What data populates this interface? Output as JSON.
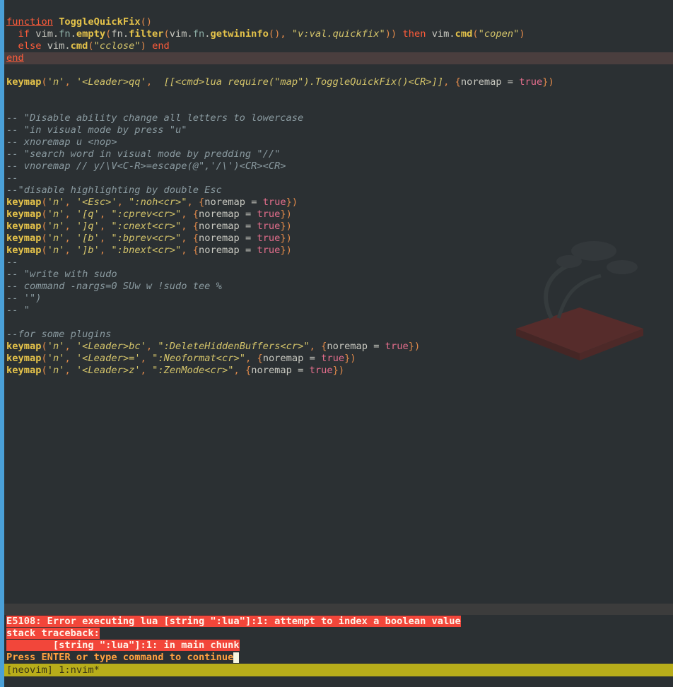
{
  "editor": {
    "lines": [
      {
        "class": "top-cut",
        "tokens": []
      },
      {
        "tokens": []
      },
      {
        "tokens": [
          [
            "kw-ul",
            "function"
          ],
          [
            "var",
            " "
          ],
          [
            "fn",
            "ToggleQuickFix"
          ],
          [
            "punc",
            "()"
          ]
        ]
      },
      {
        "tokens": [
          [
            "var",
            "  "
          ],
          [
            "kw",
            "if"
          ],
          [
            "var",
            " vim."
          ],
          [
            "mod",
            "fn"
          ],
          [
            "var",
            "."
          ],
          [
            "fn",
            "empty"
          ],
          [
            "punc",
            "("
          ],
          [
            "var",
            "fn."
          ],
          [
            "fn",
            "filter"
          ],
          [
            "punc",
            "("
          ],
          [
            "var",
            "vim."
          ],
          [
            "mod",
            "fn"
          ],
          [
            "var",
            "."
          ],
          [
            "fn",
            "getwininfo"
          ],
          [
            "punc",
            "(),"
          ],
          [
            "var",
            " "
          ],
          [
            "str",
            "\"v:val.quickfix\""
          ],
          [
            "punc",
            "))"
          ],
          [
            "var",
            " "
          ],
          [
            "kw",
            "then"
          ],
          [
            "var",
            " vim."
          ],
          [
            "fn",
            "cmd"
          ],
          [
            "punc",
            "("
          ],
          [
            "str",
            "\"copen\""
          ],
          [
            "punc",
            ")"
          ]
        ]
      },
      {
        "tokens": [
          [
            "var",
            "  "
          ],
          [
            "kw",
            "else"
          ],
          [
            "var",
            " vim."
          ],
          [
            "fn",
            "cmd"
          ],
          [
            "punc",
            "("
          ],
          [
            "str",
            "\"cclose\""
          ],
          [
            "punc",
            ")"
          ],
          [
            "var",
            " "
          ],
          [
            "kw",
            "end"
          ]
        ]
      },
      {
        "class": "cursorline",
        "tokens": [
          [
            "kw-ul",
            "end"
          ]
        ]
      },
      {
        "tokens": []
      },
      {
        "tokens": [
          [
            "fn",
            "keymap"
          ],
          [
            "punc",
            "("
          ],
          [
            "str",
            "'n'"
          ],
          [
            "punc",
            ","
          ],
          [
            "var",
            " "
          ],
          [
            "str",
            "'<Leader>qq'"
          ],
          [
            "punc",
            ","
          ],
          [
            "var",
            "  "
          ],
          [
            "str",
            "[[<cmd>lua require(\"map\").ToggleQuickFix()<CR>]]"
          ],
          [
            "punc",
            ","
          ],
          [
            "var",
            " "
          ],
          [
            "punc",
            "{"
          ],
          [
            "var",
            "noremap = "
          ],
          [
            "bool",
            "true"
          ],
          [
            "punc",
            "})"
          ]
        ]
      },
      {
        "tokens": []
      },
      {
        "tokens": []
      },
      {
        "tokens": [
          [
            "cmt",
            "-- \"Disable ability change all letters to lowercase"
          ]
        ]
      },
      {
        "tokens": [
          [
            "cmt",
            "-- \"in visual mode by press \"u\""
          ]
        ]
      },
      {
        "tokens": [
          [
            "cmt",
            "-- xnoremap u <nop>"
          ]
        ]
      },
      {
        "tokens": [
          [
            "cmt",
            "-- \"search word in visual mode by predding \"//\""
          ]
        ]
      },
      {
        "tokens": [
          [
            "cmt",
            "-- vnoremap // y/\\V<C-R>=escape(@\",'/\\')<CR><CR>"
          ]
        ]
      },
      {
        "tokens": [
          [
            "cmt",
            "--"
          ]
        ]
      },
      {
        "tokens": [
          [
            "cmt",
            "--\"disable highlighting by double Esc"
          ]
        ]
      },
      {
        "tokens": [
          [
            "fn",
            "keymap"
          ],
          [
            "punc",
            "("
          ],
          [
            "str",
            "'n'"
          ],
          [
            "punc",
            ","
          ],
          [
            "var",
            " "
          ],
          [
            "str",
            "'<Esc>'"
          ],
          [
            "punc",
            ","
          ],
          [
            "var",
            " "
          ],
          [
            "str",
            "\":noh<cr>\""
          ],
          [
            "punc",
            ","
          ],
          [
            "var",
            " "
          ],
          [
            "punc",
            "{"
          ],
          [
            "var",
            "noremap = "
          ],
          [
            "bool",
            "true"
          ],
          [
            "punc",
            "})"
          ]
        ]
      },
      {
        "tokens": [
          [
            "fn",
            "keymap"
          ],
          [
            "punc",
            "("
          ],
          [
            "str",
            "'n'"
          ],
          [
            "punc",
            ","
          ],
          [
            "var",
            " "
          ],
          [
            "str",
            "'[q'"
          ],
          [
            "punc",
            ","
          ],
          [
            "var",
            " "
          ],
          [
            "str",
            "\":cprev<cr>\""
          ],
          [
            "punc",
            ","
          ],
          [
            "var",
            " "
          ],
          [
            "punc",
            "{"
          ],
          [
            "var",
            "noremap = "
          ],
          [
            "bool",
            "true"
          ],
          [
            "punc",
            "})"
          ]
        ]
      },
      {
        "tokens": [
          [
            "fn",
            "keymap"
          ],
          [
            "punc",
            "("
          ],
          [
            "str",
            "'n'"
          ],
          [
            "punc",
            ","
          ],
          [
            "var",
            " "
          ],
          [
            "str",
            "']q'"
          ],
          [
            "punc",
            ","
          ],
          [
            "var",
            " "
          ],
          [
            "str",
            "\":cnext<cr>\""
          ],
          [
            "punc",
            ","
          ],
          [
            "var",
            " "
          ],
          [
            "punc",
            "{"
          ],
          [
            "var",
            "noremap = "
          ],
          [
            "bool",
            "true"
          ],
          [
            "punc",
            "})"
          ]
        ]
      },
      {
        "tokens": [
          [
            "fn",
            "keymap"
          ],
          [
            "punc",
            "("
          ],
          [
            "str",
            "'n'"
          ],
          [
            "punc",
            ","
          ],
          [
            "var",
            " "
          ],
          [
            "str",
            "'[b'"
          ],
          [
            "punc",
            ","
          ],
          [
            "var",
            " "
          ],
          [
            "str",
            "\":bprev<cr>\""
          ],
          [
            "punc",
            ","
          ],
          [
            "var",
            " "
          ],
          [
            "punc",
            "{"
          ],
          [
            "var",
            "noremap = "
          ],
          [
            "bool",
            "true"
          ],
          [
            "punc",
            "})"
          ]
        ]
      },
      {
        "tokens": [
          [
            "fn",
            "keymap"
          ],
          [
            "punc",
            "("
          ],
          [
            "str",
            "'n'"
          ],
          [
            "punc",
            ","
          ],
          [
            "var",
            " "
          ],
          [
            "str",
            "']b'"
          ],
          [
            "punc",
            ","
          ],
          [
            "var",
            " "
          ],
          [
            "str",
            "\":bnext<cr>\""
          ],
          [
            "punc",
            ","
          ],
          [
            "var",
            " "
          ],
          [
            "punc",
            "{"
          ],
          [
            "var",
            "noremap = "
          ],
          [
            "bool",
            "true"
          ],
          [
            "punc",
            "})"
          ]
        ]
      },
      {
        "tokens": [
          [
            "cmt",
            "--"
          ]
        ]
      },
      {
        "tokens": [
          [
            "cmt",
            "-- \"write with sudo"
          ]
        ]
      },
      {
        "tokens": [
          [
            "cmt",
            "-- command -nargs=0 SUw w !sudo tee %"
          ]
        ]
      },
      {
        "tokens": [
          [
            "cmt",
            "-- '\")"
          ]
        ]
      },
      {
        "tokens": [
          [
            "cmt",
            "-- \""
          ]
        ]
      },
      {
        "tokens": []
      },
      {
        "tokens": [
          [
            "cmt",
            "--for some plugins"
          ]
        ]
      },
      {
        "tokens": [
          [
            "fn",
            "keymap"
          ],
          [
            "punc",
            "("
          ],
          [
            "str",
            "'n'"
          ],
          [
            "punc",
            ","
          ],
          [
            "var",
            " "
          ],
          [
            "str",
            "'<Leader>bc'"
          ],
          [
            "punc",
            ","
          ],
          [
            "var",
            " "
          ],
          [
            "str",
            "\":DeleteHiddenBuffers<cr>\""
          ],
          [
            "punc",
            ","
          ],
          [
            "var",
            " "
          ],
          [
            "punc",
            "{"
          ],
          [
            "var",
            "noremap = "
          ],
          [
            "bool",
            "true"
          ],
          [
            "punc",
            "})"
          ]
        ]
      },
      {
        "tokens": [
          [
            "fn",
            "keymap"
          ],
          [
            "punc",
            "("
          ],
          [
            "str",
            "'n'"
          ],
          [
            "punc",
            ","
          ],
          [
            "var",
            " "
          ],
          [
            "str",
            "'<Leader>='"
          ],
          [
            "punc",
            ","
          ],
          [
            "var",
            " "
          ],
          [
            "str",
            "\":Neoformat<cr>\""
          ],
          [
            "punc",
            ","
          ],
          [
            "var",
            " "
          ],
          [
            "punc",
            "{"
          ],
          [
            "var",
            "noremap = "
          ],
          [
            "bool",
            "true"
          ],
          [
            "punc",
            "})"
          ]
        ]
      },
      {
        "tokens": [
          [
            "fn",
            "keymap"
          ],
          [
            "punc",
            "("
          ],
          [
            "str",
            "'n'"
          ],
          [
            "punc",
            ","
          ],
          [
            "var",
            " "
          ],
          [
            "str",
            "'<Leader>z'"
          ],
          [
            "punc",
            ","
          ],
          [
            "var",
            " "
          ],
          [
            "str",
            "\":ZenMode<cr>\""
          ],
          [
            "punc",
            ","
          ],
          [
            "var",
            " "
          ],
          [
            "punc",
            "{"
          ],
          [
            "var",
            "noremap = "
          ],
          [
            "bool",
            "true"
          ],
          [
            "punc",
            "})"
          ]
        ]
      }
    ]
  },
  "messages": {
    "error": "E5108: Error executing lua [string \":lua\"]:1: attempt to index a boolean value",
    "traceback_label": "stack traceback:",
    "traceback_entry": "        [string \":lua\"]:1: in main chunk",
    "prompt": "Press ENTER or type command to continue"
  },
  "statusline": {
    "text": "[neovim] 1:nvim*"
  },
  "colors": {
    "background": "#2b3033",
    "error_bg": "#f2463a",
    "status_bg": "#b8ad1a",
    "accent": "#4aa0d8"
  }
}
